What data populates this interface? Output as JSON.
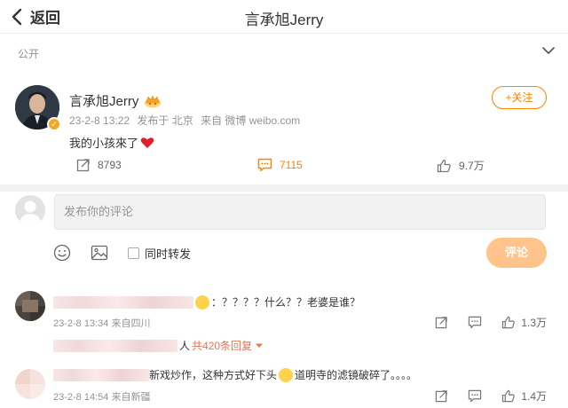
{
  "header": {
    "back_label": "返回",
    "title": "言承旭Jerry"
  },
  "visibility": {
    "label": "公开"
  },
  "post": {
    "author": "言承旭Jerry",
    "date": "23-2-8 13:22",
    "location": "发布于 北京",
    "source": "来自 微博 weibo.com",
    "follow_label": "+关注",
    "text": "我的小孩來了",
    "reposts": "8793",
    "comments": "7115",
    "likes": "9.7万"
  },
  "comment_box": {
    "placeholder": "发布你的评论",
    "repost_label": "同时转发",
    "submit_label": "评论"
  },
  "comments": [
    {
      "text_suffix": "：？？？？什么？？老婆是谁？",
      "time": "23-2-8 13:34",
      "source": "来自四川",
      "likes": "1.3万",
      "reply_suffix": "人",
      "reply_link": "共420条回复"
    },
    {
      "text_part1": "新戏炒作，这种方式好下头",
      "text_part2": "道明寺的滤镜破碎了。。。。",
      "time": "23-2-8 14:54",
      "source": "来自新疆",
      "likes": "1.4万"
    }
  ],
  "colors": {
    "accent": "#ff8200",
    "reply_link": "#eb7350",
    "submit_disabled": "#ffc48c"
  }
}
